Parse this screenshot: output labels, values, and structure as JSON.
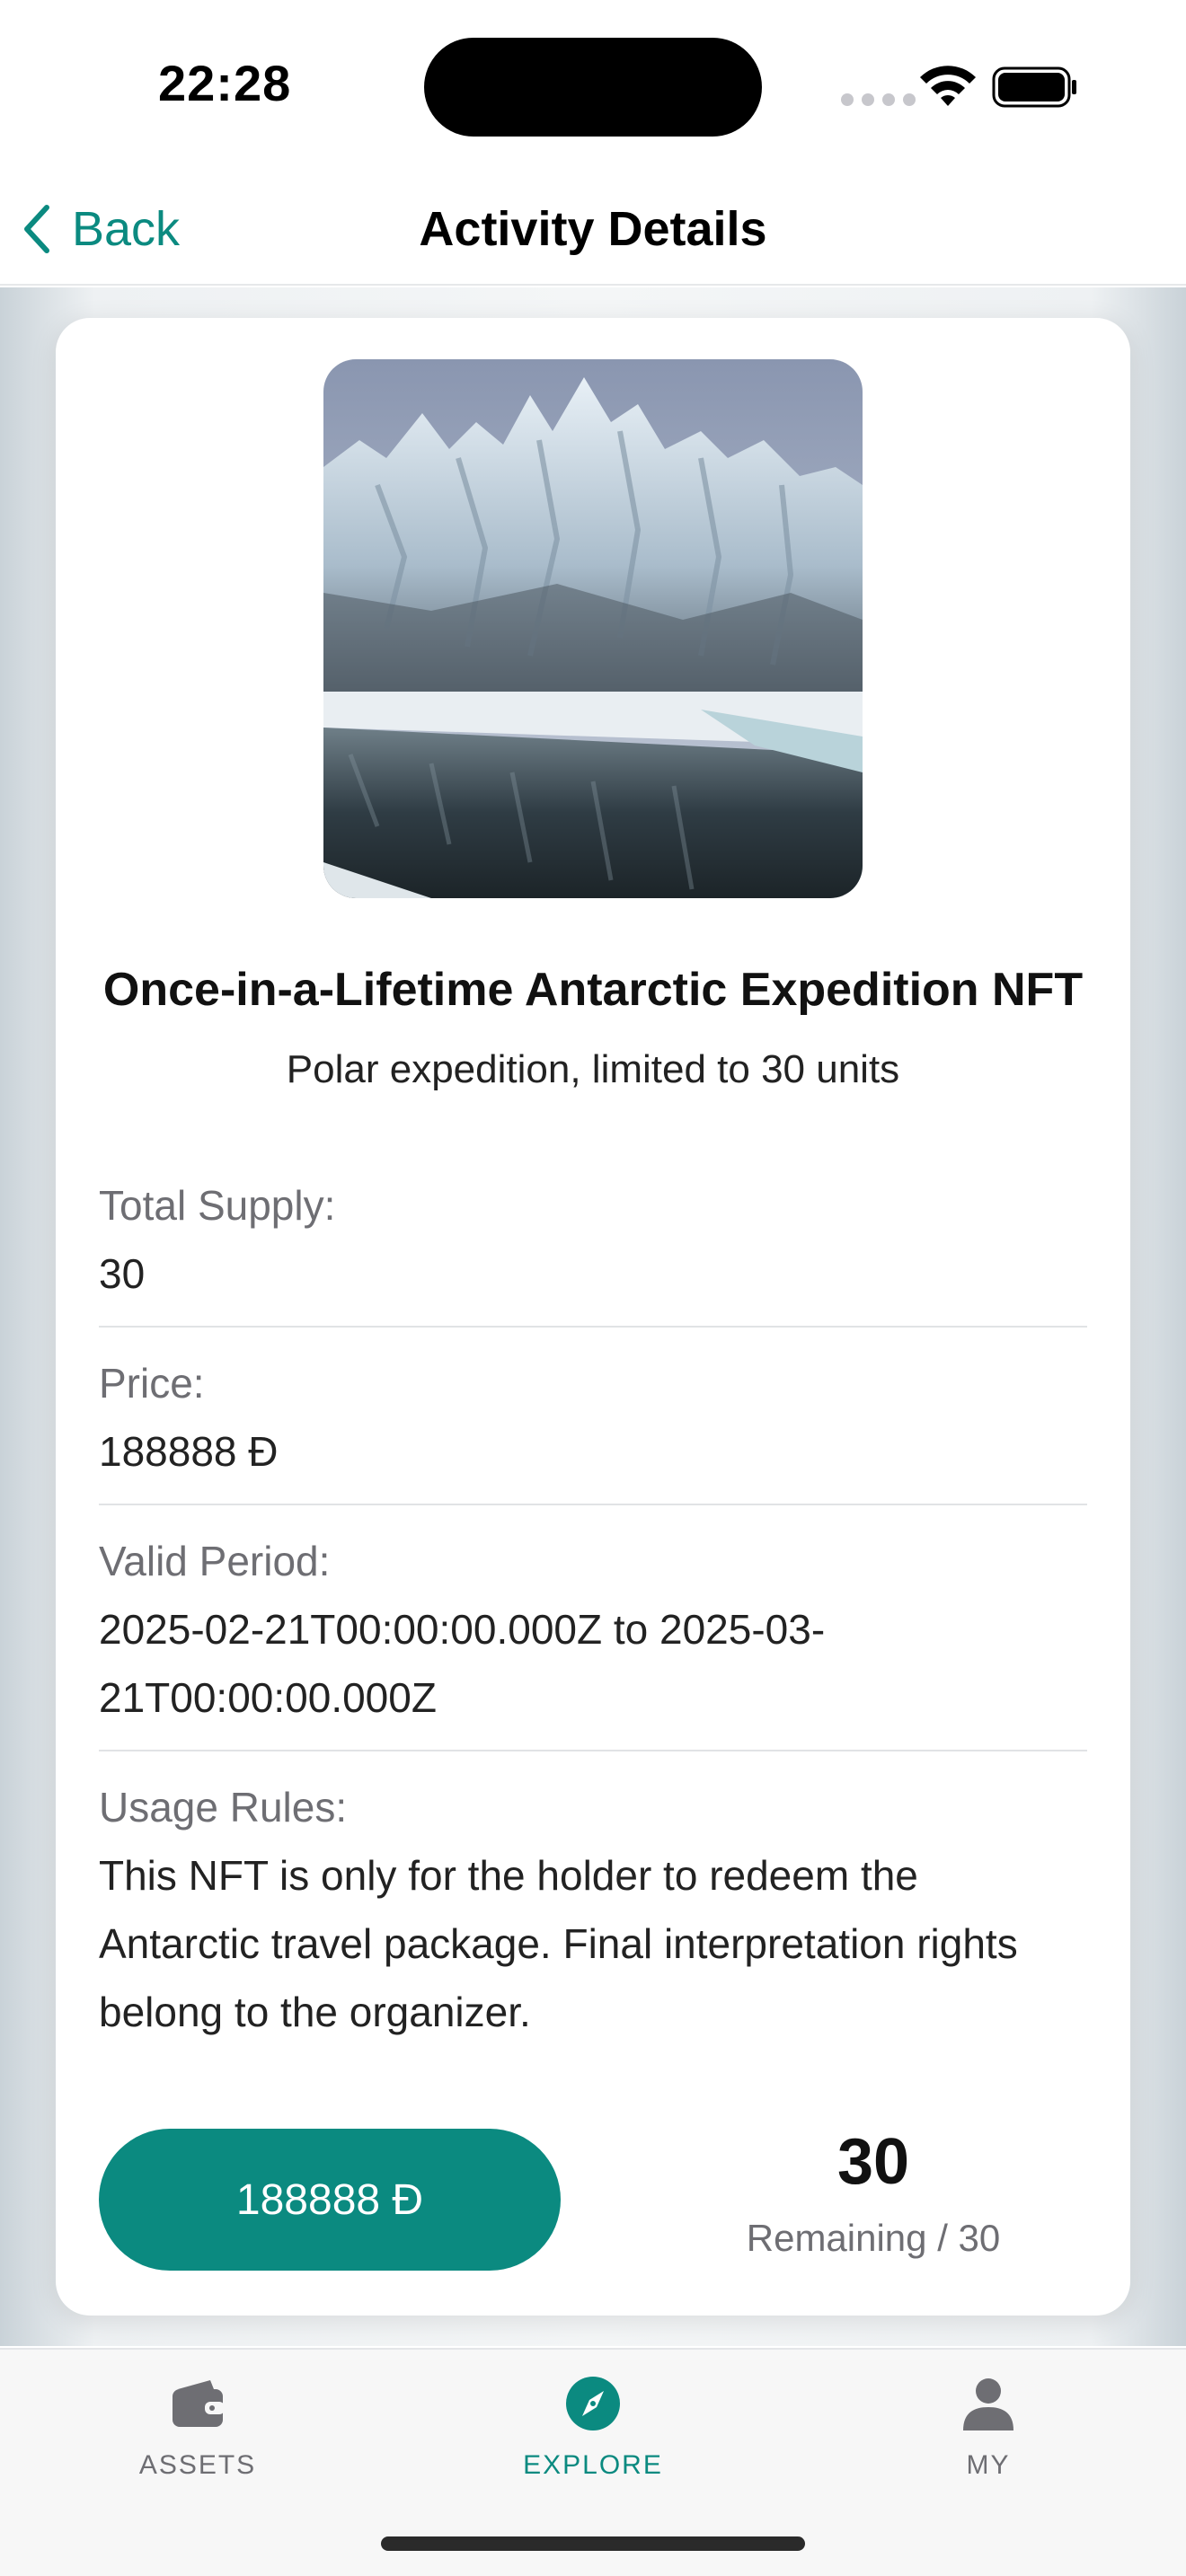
{
  "status_bar": {
    "time": "22:28"
  },
  "nav": {
    "back_label": "Back",
    "title": "Activity Details"
  },
  "nft": {
    "title": "Once-in-a-Lifetime Antarctic Expedition NFT",
    "subtitle": "Polar expedition, limited to 30 units",
    "image_icon": "glacier-photo"
  },
  "details": [
    {
      "label": "Total Supply:",
      "value": "30"
    },
    {
      "label": "Price:",
      "value": "188888 Đ"
    },
    {
      "label": "Valid Period:",
      "value_line1": "2025-02-21T00:00:00.000Z to 2025-03-",
      "value_line2": "21T00:00:00.000Z"
    },
    {
      "label": "Usage Rules:",
      "value_line1": "This NFT is only for the holder to redeem the",
      "value_line2": "Antarctic travel package. Final interpretation rights",
      "value_line3": "belong to the organizer."
    }
  ],
  "purchase": {
    "button_label": "188888 Đ",
    "remaining_count": "30",
    "remaining_label": "Remaining / 30"
  },
  "tabs": [
    {
      "label": "ASSETS",
      "icon": "wallet-icon",
      "active": false
    },
    {
      "label": "EXPLORE",
      "icon": "compass-icon",
      "active": true
    },
    {
      "label": "MY",
      "icon": "person-icon",
      "active": false
    }
  ],
  "colors": {
    "accent": "#0b8a80",
    "text_primary": "#111111",
    "text_secondary": "#6e6e73"
  }
}
